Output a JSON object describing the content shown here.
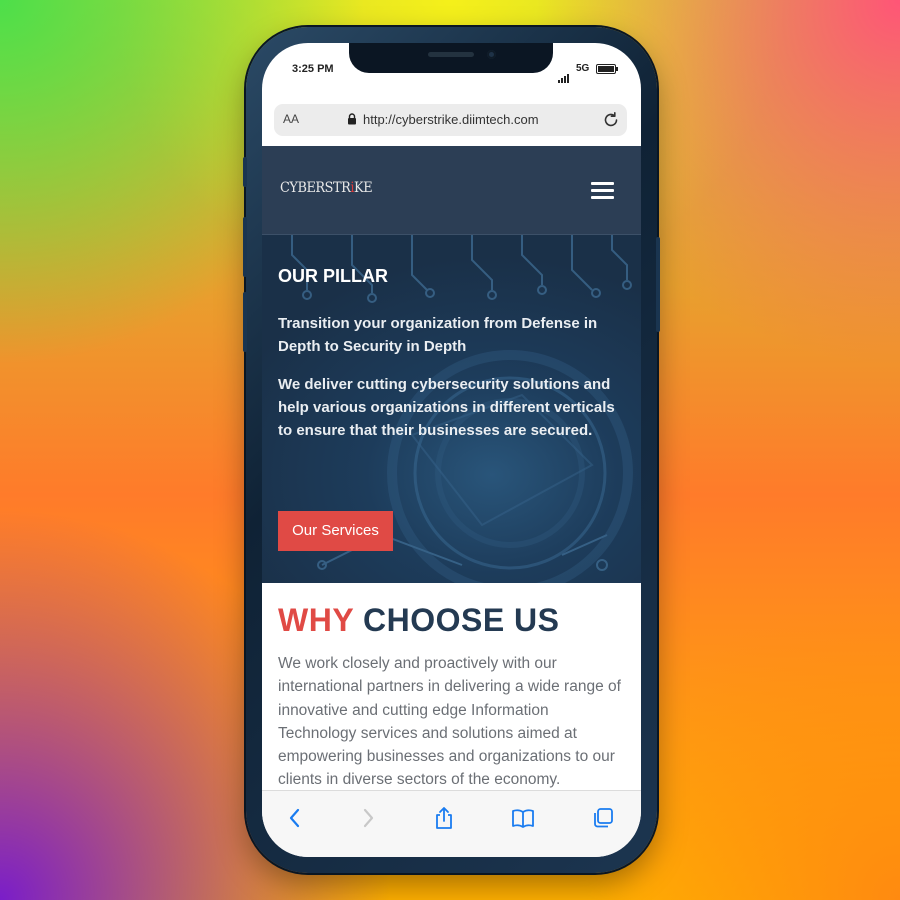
{
  "status": {
    "time": "3:25 PM",
    "network": "5G"
  },
  "browser": {
    "text_size": "AA",
    "url": "http://cyberstrike.diimtech.com"
  },
  "site": {
    "logo": {
      "part1": "CYBERSTR",
      "part2": "i",
      "part3": "KE"
    },
    "hero": {
      "title": "OUR PILLAR",
      "subtitle": "Transition your organization from Defense in Depth to Security in Depth",
      "description": "We deliver cutting cybersecurity solutions and help various organizations in different verticals to ensure that their businesses are secured.",
      "button": "Our Services"
    },
    "why": {
      "title_red": "WHY",
      "title_dark": "CHOOSE US",
      "text": "We work closely and proactively with our international partners in delivering a wide range of innovative and cutting edge Information Technology services and solutions aimed at empowering businesses and organizations to our clients in diverse sectors of the economy."
    }
  },
  "toolbar": {
    "icons": [
      "back-icon",
      "forward-icon",
      "share-icon",
      "bookmarks-icon",
      "tabs-icon"
    ]
  },
  "colors": {
    "accent": "#e04a45",
    "nav": "#2c3e55",
    "ios_blue": "#1a7cf0"
  }
}
